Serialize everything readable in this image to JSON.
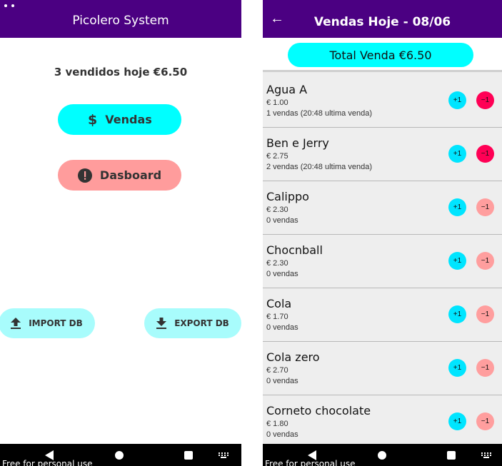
{
  "left_screen": {
    "app_title": "Picolero System",
    "summary": "3 vendidos hoje €6.50",
    "vendas_label": "Vendas",
    "dashboard_label": "Dasboard",
    "import_label": "IMPORT DB",
    "export_label": "EXPORT DB",
    "watermark": "Free for personal use"
  },
  "right_screen": {
    "title": "Vendas Hoje - 08/06",
    "back_icon": "←",
    "total": "Total Venda €6.50",
    "watermark": "Free for personal use",
    "items": [
      {
        "name": "Agua A",
        "price": "€ 1.00",
        "sales": "1 vendas   (20:48 ultima venda)",
        "plus": "+1",
        "minus": "−1",
        "minus_active": true
      },
      {
        "name": "Ben e Jerry",
        "price": "€ 2.75",
        "sales": "2 vendas   (20:48 ultima venda)",
        "plus": "+1",
        "minus": "−1",
        "minus_active": true
      },
      {
        "name": "Calippo",
        "price": "€ 2.30",
        "sales": "0 vendas",
        "plus": "+1",
        "minus": "−1",
        "minus_active": false
      },
      {
        "name": "Chocnball",
        "price": "€ 2.30",
        "sales": "0 vendas",
        "plus": "+1",
        "minus": "−1",
        "minus_active": false
      },
      {
        "name": "Cola",
        "price": "€ 1.70",
        "sales": "0 vendas",
        "plus": "+1",
        "minus": "−1",
        "minus_active": false
      },
      {
        "name": "Cola zero",
        "price": "€ 2.70",
        "sales": "0 vendas",
        "plus": "+1",
        "minus": "−1",
        "minus_active": false
      },
      {
        "name": "Corneto chocolate",
        "price": "€ 1.80",
        "sales": "0 vendas",
        "plus": "+1",
        "minus": "−1",
        "minus_active": false
      }
    ]
  },
  "colors": {
    "appbar": "#4b0082",
    "cyan": "#00ffff",
    "pink": "#ff9c9c",
    "minus_active": "#ff0055",
    "minus_inactive": "#ff9e9e"
  },
  "icons": {
    "vendas": "dollar-icon",
    "dashboard": "alert-circle-icon",
    "import": "upload-icon",
    "export": "download-icon",
    "back": "arrow-left-icon"
  }
}
